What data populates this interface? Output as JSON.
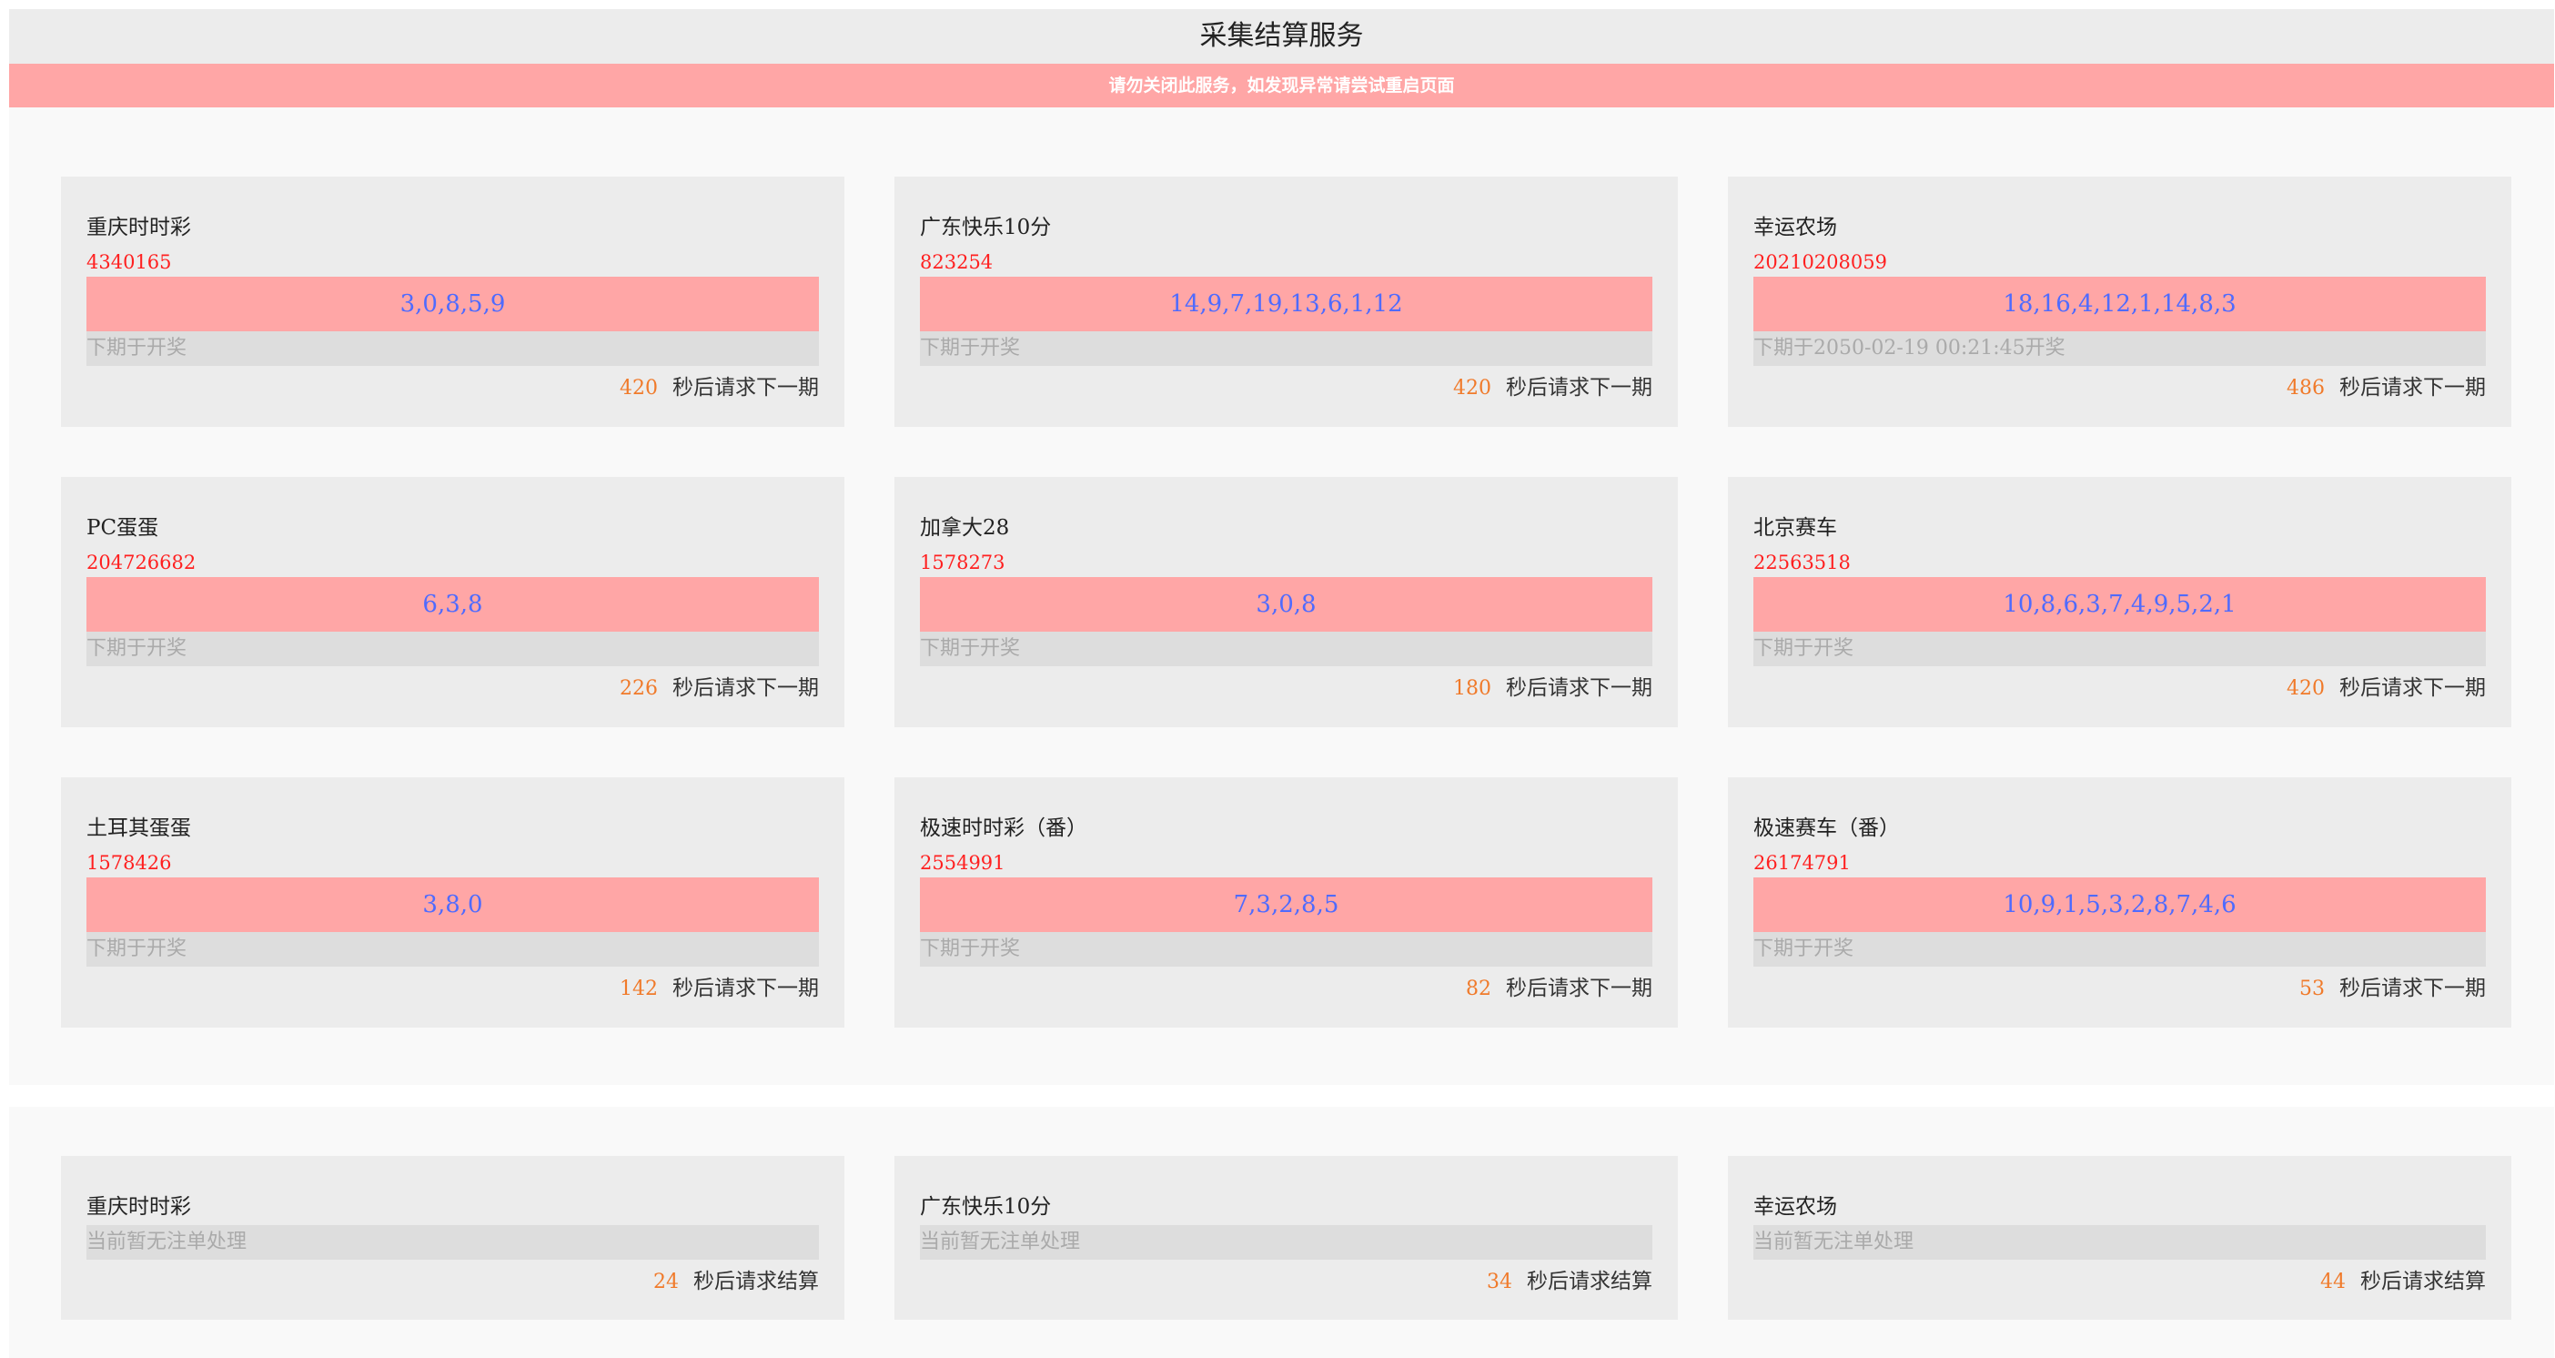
{
  "header": {
    "title": "采集结算服务",
    "warning": "请勿关闭此服务，如发现异常请尝试重启页面"
  },
  "collect_suffix": "秒后请求下一期",
  "settle_suffix": "秒后请求结算",
  "collect_cards": [
    {
      "name": "重庆时时彩",
      "issue": "4340165",
      "numbers": "3,0,8,5,9",
      "next": "下期于开奖",
      "countdown": "420"
    },
    {
      "name": "广东快乐10分",
      "issue": "823254",
      "numbers": "14,9,7,19,13,6,1,12",
      "next": "下期于开奖",
      "countdown": "420"
    },
    {
      "name": "幸运农场",
      "issue": "20210208059",
      "numbers": "18,16,4,12,1,14,8,3",
      "next": "下期于2050-02-19 00:21:45开奖",
      "countdown": "486"
    },
    {
      "name": "PC蛋蛋",
      "issue": "204726682",
      "numbers": "6,3,8",
      "next": "下期于开奖",
      "countdown": "226"
    },
    {
      "name": "加拿大28",
      "issue": "1578273",
      "numbers": "3,0,8",
      "next": "下期于开奖",
      "countdown": "180"
    },
    {
      "name": "北京赛车",
      "issue": "22563518",
      "numbers": "10,8,6,3,7,4,9,5,2,1",
      "next": "下期于开奖",
      "countdown": "420"
    },
    {
      "name": "土耳其蛋蛋",
      "issue": "1578426",
      "numbers": "3,8,0",
      "next": "下期于开奖",
      "countdown": "142"
    },
    {
      "name": "极速时时彩（番）",
      "issue": "2554991",
      "numbers": "7,3,2,8,5",
      "next": "下期于开奖",
      "countdown": "82"
    },
    {
      "name": "极速赛车（番）",
      "issue": "26174791",
      "numbers": "10,9,1,5,3,2,8,7,4,6",
      "next": "下期于开奖",
      "countdown": "53"
    }
  ],
  "settle_cards": [
    {
      "name": "重庆时时彩",
      "status": "当前暂无注单处理",
      "countdown": "24"
    },
    {
      "name": "广东快乐10分",
      "status": "当前暂无注单处理",
      "countdown": "34"
    },
    {
      "name": "幸运农场",
      "status": "当前暂无注单处理",
      "countdown": "44"
    }
  ]
}
